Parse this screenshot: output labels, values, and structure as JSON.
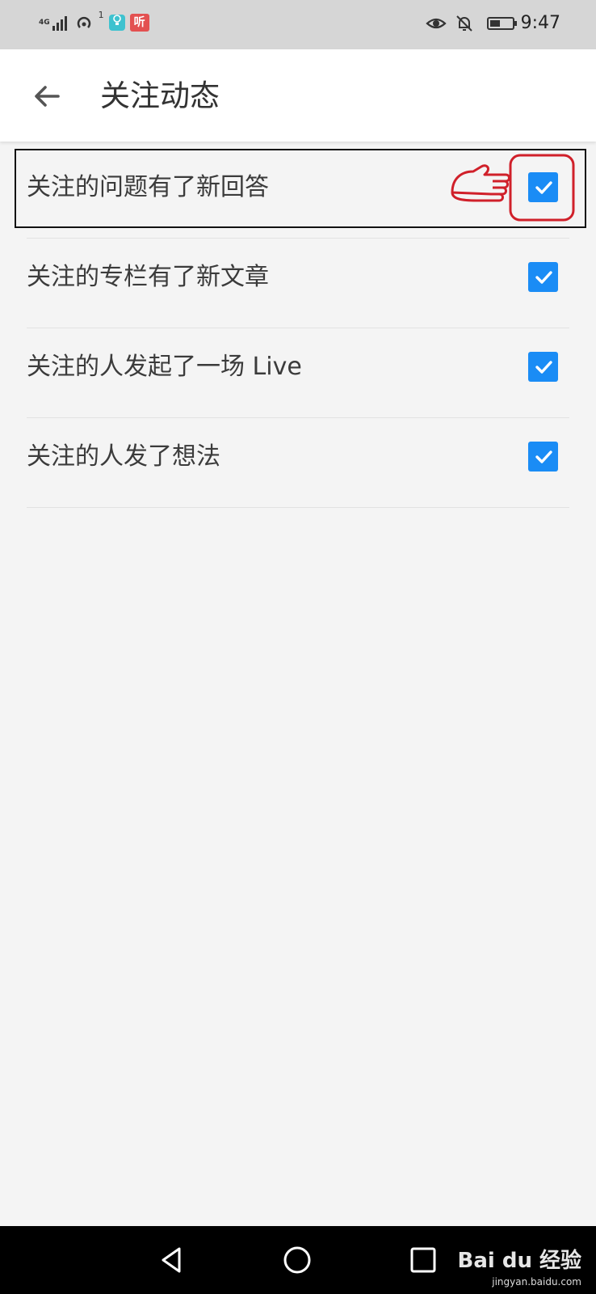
{
  "status_bar": {
    "network": "4G",
    "network_sub": "1+",
    "hotspot_count": "1",
    "app_badge_1": "bulb-icon",
    "app_badge_2_text": "听",
    "time": "9:47",
    "battery_level": 0.45
  },
  "header": {
    "title": "关注动态"
  },
  "settings": [
    {
      "label": "关注的问题有了新回答",
      "checked": true
    },
    {
      "label": "关注的专栏有了新文章",
      "checked": true
    },
    {
      "label": "关注的人发起了一场 Live",
      "checked": true
    },
    {
      "label": "关注的人发了想法",
      "checked": true
    }
  ],
  "colors": {
    "checkbox": "#1a8cf5",
    "annotation_red": "#d0202a"
  },
  "watermark": {
    "brand": "Bai du 经验",
    "url": "jingyan.baidu.com"
  }
}
